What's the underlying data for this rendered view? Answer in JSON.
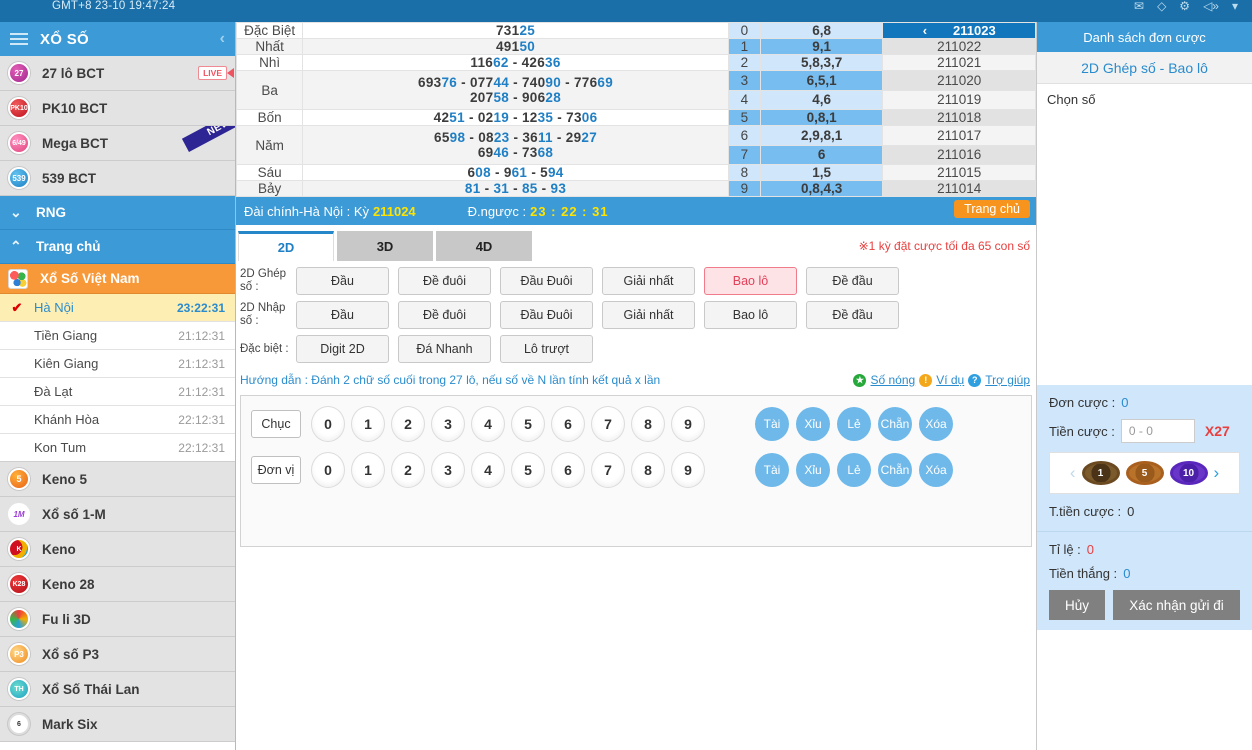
{
  "topbar": {
    "clock": "GMT+8 23-10 19:47:24",
    "icons": [
      "mail-icon",
      "ticket-icon",
      "gear-icon",
      "speaker-icon",
      "wifi-icon"
    ]
  },
  "sidebar": {
    "header_title": "XỔ SỐ",
    "collapse_icon": "chevron-left-icon",
    "games": [
      {
        "label": "27 lô BCT",
        "icon_text": "27",
        "badge": "LIVE"
      },
      {
        "label": "PK10 BCT",
        "icon_text": "PK10",
        "badge": ""
      },
      {
        "label": "Mega BCT",
        "icon_text": "6/49",
        "badge": "NEW"
      },
      {
        "label": "539 BCT",
        "icon_text": "539",
        "badge": ""
      }
    ],
    "sections": [
      {
        "label": "RNG",
        "arrow": "▼"
      },
      {
        "label": "Trang chủ",
        "arrow": "▲"
      }
    ],
    "sub_header": "Xổ Số Việt Nam",
    "cities": [
      {
        "name": "Hà Nội",
        "time": "23:22:31",
        "active": true
      },
      {
        "name": "Tiền Giang",
        "time": "21:12:31",
        "active": false
      },
      {
        "name": "Kiên Giang",
        "time": "21:12:31",
        "active": false
      },
      {
        "name": "Đà Lạt",
        "time": "21:12:31",
        "active": false
      },
      {
        "name": "Khánh Hòa",
        "time": "22:12:31",
        "active": false
      },
      {
        "name": "Kon Tum",
        "time": "22:12:31",
        "active": false
      }
    ],
    "more_games": [
      {
        "label": "Keno 5"
      },
      {
        "label": "Xổ số 1-M"
      },
      {
        "label": "Keno"
      },
      {
        "label": "Keno 28"
      },
      {
        "label": "Fu li 3D"
      },
      {
        "label": "Xổ số P3"
      },
      {
        "label": "Xổ Số Thái Lan"
      },
      {
        "label": "Mark Six"
      }
    ]
  },
  "results": {
    "prizes": [
      {
        "name": "Đặc Biệt",
        "lines": [
          [
            {
              "p": "731",
              "h": "25"
            }
          ]
        ]
      },
      {
        "name": "Nhất",
        "lines": [
          [
            {
              "p": "491",
              "h": "50"
            }
          ]
        ]
      },
      {
        "name": "Nhì",
        "lines": [
          [
            {
              "p": "116",
              "h": "62"
            },
            {
              "p": "426",
              "h": "36"
            }
          ]
        ]
      },
      {
        "name": "Ba",
        "lines": [
          [
            {
              "p": "693",
              "h": "76"
            },
            {
              "p": "077",
              "h": "44"
            },
            {
              "p": "740",
              "h": "90"
            },
            {
              "p": "776",
              "h": "69"
            }
          ],
          [
            {
              "p": "207",
              "h": "58"
            },
            {
              "p": "906",
              "h": "28"
            }
          ]
        ]
      },
      {
        "name": "Bốn",
        "lines": [
          [
            {
              "p": "42",
              "h": "51"
            },
            {
              "p": "02",
              "h": "19"
            },
            {
              "p": "12",
              "h": "35"
            },
            {
              "p": "73",
              "h": "06"
            }
          ]
        ]
      },
      {
        "name": "Năm",
        "lines": [
          [
            {
              "p": "65",
              "h": "98"
            },
            {
              "p": "08",
              "h": "23"
            },
            {
              "p": "36",
              "h": "11"
            },
            {
              "p": "29",
              "h": "27"
            }
          ],
          [
            {
              "p": "69",
              "h": "46"
            },
            {
              "p": "73",
              "h": "68"
            }
          ]
        ]
      },
      {
        "name": "Sáu",
        "lines": [
          [
            {
              "p": "6",
              "h": "08"
            },
            {
              "p": "9",
              "h": "61"
            },
            {
              "p": "5",
              "h": "94"
            }
          ]
        ]
      },
      {
        "name": "Bảy",
        "lines": [
          [
            {
              "p": "",
              "h": "81"
            },
            {
              "p": "",
              "h": "31"
            },
            {
              "p": "",
              "h": "85"
            },
            {
              "p": "",
              "h": "93"
            }
          ]
        ]
      }
    ],
    "digit_rows": [
      {
        "digit": "0",
        "tails": "6,8"
      },
      {
        "digit": "1",
        "tails": "9,1"
      },
      {
        "digit": "2",
        "tails": "5,8,3,7"
      },
      {
        "digit": "3",
        "tails": "6,5,1"
      },
      {
        "digit": "4",
        "tails": "4,6"
      },
      {
        "digit": "5",
        "tails": "0,8,1"
      },
      {
        "digit": "6",
        "tails": "2,9,8,1"
      },
      {
        "digit": "7",
        "tails": "6"
      },
      {
        "digit": "8",
        "tails": "1,5"
      },
      {
        "digit": "9",
        "tails": "0,8,4,3"
      }
    ],
    "periods": [
      {
        "id": "211023",
        "current": true,
        "prev_icon": "chevron-left-icon"
      },
      {
        "id": "211022",
        "current": false
      },
      {
        "id": "211021",
        "current": false
      },
      {
        "id": "211020",
        "current": false
      },
      {
        "id": "211019",
        "current": false
      },
      {
        "id": "211018",
        "current": false
      },
      {
        "id": "211017",
        "current": false
      },
      {
        "id": "211016",
        "current": false
      },
      {
        "id": "211015",
        "current": false
      },
      {
        "id": "211014",
        "current": false
      }
    ]
  },
  "infobar": {
    "station_label": "Đài chính-Hà Nội  :  Kỳ",
    "period": "211024",
    "countdown_label": "Đ.ngược :",
    "countdown": "23 : 22 : 31",
    "home_button": "Trang chủ"
  },
  "tabs": {
    "items": [
      {
        "label": "2D",
        "active": true
      },
      {
        "label": "3D",
        "active": false
      },
      {
        "label": "4D",
        "active": false
      }
    ],
    "note": "※1 kỳ đặt cược tối đa 65 con số"
  },
  "bet_types": [
    {
      "row_label": "2D Ghép số :",
      "buttons": [
        {
          "label": "Đầu",
          "selected": false
        },
        {
          "label": "Đề đuôi",
          "selected": false
        },
        {
          "label": "Đầu Đuôi",
          "selected": false
        },
        {
          "label": "Giải nhất",
          "selected": false
        },
        {
          "label": "Bao lô",
          "selected": true
        },
        {
          "label": "Đề đầu",
          "selected": false
        }
      ]
    },
    {
      "row_label": "2D Nhập số :",
      "buttons": [
        {
          "label": "Đầu",
          "selected": false
        },
        {
          "label": "Đề đuôi",
          "selected": false
        },
        {
          "label": "Đầu Đuôi",
          "selected": false
        },
        {
          "label": "Giải nhất",
          "selected": false
        },
        {
          "label": "Bao lô",
          "selected": false
        },
        {
          "label": "Đề đầu",
          "selected": false
        }
      ]
    },
    {
      "row_label": "Đặc biệt :",
      "buttons": [
        {
          "label": "Digit 2D",
          "selected": false
        },
        {
          "label": "Đá Nhanh",
          "selected": false
        },
        {
          "label": "Lô trượt",
          "selected": false
        }
      ]
    }
  ],
  "guide": {
    "text": "Hướng dẫn : Đánh 2 chữ số cuối trong 27 lô, nếu số về N lần tính kết quả x lần",
    "links": [
      {
        "label": "Số nóng",
        "icon": "star-icon"
      },
      {
        "label": "Ví dụ",
        "icon": "exclamation-icon"
      },
      {
        "label": "Trợ giúp",
        "icon": "question-icon"
      }
    ]
  },
  "numpad": {
    "rows": [
      {
        "label": "Chục",
        "numbers": [
          "0",
          "1",
          "2",
          "3",
          "4",
          "5",
          "6",
          "7",
          "8",
          "9"
        ],
        "ops": [
          "Tài",
          "Xỉu",
          "Lẻ",
          "Chẵn",
          "Xóa"
        ]
      },
      {
        "label": "Đơn vị",
        "numbers": [
          "0",
          "1",
          "2",
          "3",
          "4",
          "5",
          "6",
          "7",
          "8",
          "9"
        ],
        "ops": [
          "Tài",
          "Xỉu",
          "Lẻ",
          "Chẵn",
          "Xóa"
        ]
      }
    ]
  },
  "right_panel": {
    "header": "Danh sách đơn cược",
    "subheader": "2D Ghép số - Bao lô",
    "choose_label": "Chọn số",
    "bet_count_label": "Đơn cược :",
    "bet_count": "0",
    "bet_money_label": "Tiền cược :",
    "bet_money_placeholder": "0 - 0",
    "multiplier": "X27",
    "chips": [
      {
        "value": "1",
        "color": "#6b4a22"
      },
      {
        "value": "5",
        "color": "#a9601f"
      },
      {
        "value": "10",
        "color": "#5a27bd"
      }
    ],
    "chip_prev_icon": "chevron-left-icon",
    "chip_next_icon": "chevron-right-icon",
    "total_label": "T.tiền cược :",
    "total": "0",
    "ratio_label": "Tỉ     lệ :",
    "ratio": "0",
    "win_label": "Tiền thắng :",
    "win": "0",
    "cancel_button": "Hủy",
    "confirm_button": "Xác nhận gửi đi"
  }
}
